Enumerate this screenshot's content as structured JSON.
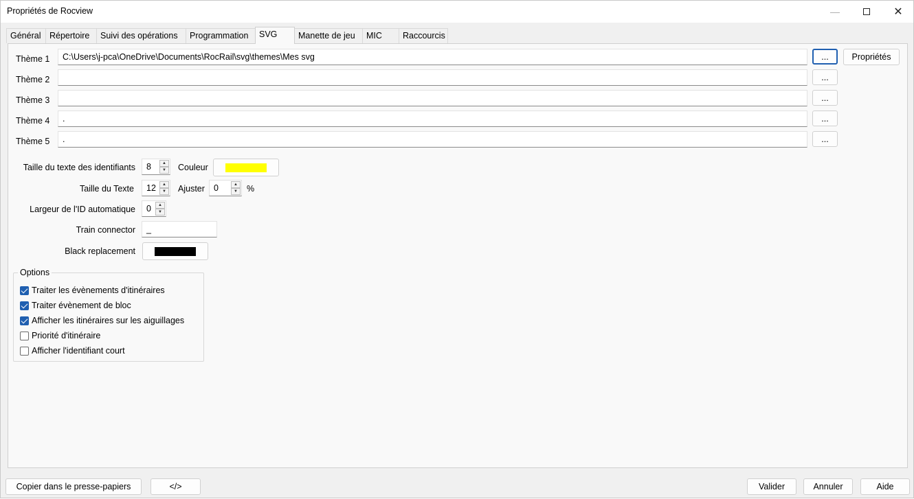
{
  "window": {
    "title": "Propriétés de Rocview",
    "minimize_icon": "minimize-icon",
    "maximize_icon": "maximize-icon",
    "close_icon": "close-icon",
    "close_glyph": "✕"
  },
  "tabs": [
    {
      "label": "Général"
    },
    {
      "label": "Répertoire"
    },
    {
      "label": "Suivi des opérations"
    },
    {
      "label": "Programmation"
    },
    {
      "label": "SVG",
      "active": true
    },
    {
      "label": "Manette de jeu"
    },
    {
      "label": "MIC"
    },
    {
      "label": "Raccourcis"
    }
  ],
  "themes": [
    {
      "label": "Thème 1",
      "value": "C:\\Users\\j-pca\\OneDrive\\Documents\\RocRail\\svg\\themes\\Mes svg",
      "browse": "..."
    },
    {
      "label": "Thème 2",
      "value": "",
      "browse": "..."
    },
    {
      "label": "Thème 3",
      "value": "",
      "browse": "..."
    },
    {
      "label": "Thème 4",
      "value": ".",
      "browse": "..."
    },
    {
      "label": "Thème 5",
      "value": ".",
      "browse": "..."
    }
  ],
  "properties_button": "Propriétés",
  "settings": {
    "id_text_size_label": "Taille du texte des identifiants",
    "id_text_size": "8",
    "color_label": "Couleur",
    "color_value": "#ffff00",
    "text_size_label": "Taille du Texte",
    "text_size": "12",
    "adjust_label": "Ajuster",
    "adjust_value": "0",
    "percent": "%",
    "auto_id_width_label": "Largeur de l'ID automatique",
    "auto_id_width": "0",
    "train_connector_label": "Train connector",
    "train_connector": "_",
    "black_replacement_label": "Black replacement",
    "black_replacement_color": "#000000"
  },
  "options": {
    "title": "Options",
    "items": [
      {
        "label": "Traiter les évènements d'itinéraires",
        "checked": true
      },
      {
        "label": "Traiter évènement de bloc",
        "checked": true
      },
      {
        "label": "Afficher les itinéraires sur les aiguillages",
        "checked": true
      },
      {
        "label": "Priorité d'itinéraire",
        "checked": false
      },
      {
        "label": "Afficher l'identifiant court",
        "checked": false
      }
    ]
  },
  "footer": {
    "copy_clipboard": "Copier dans le presse-papiers",
    "xml": "</>",
    "validate": "Valider",
    "cancel": "Annuler",
    "help": "Aide"
  }
}
